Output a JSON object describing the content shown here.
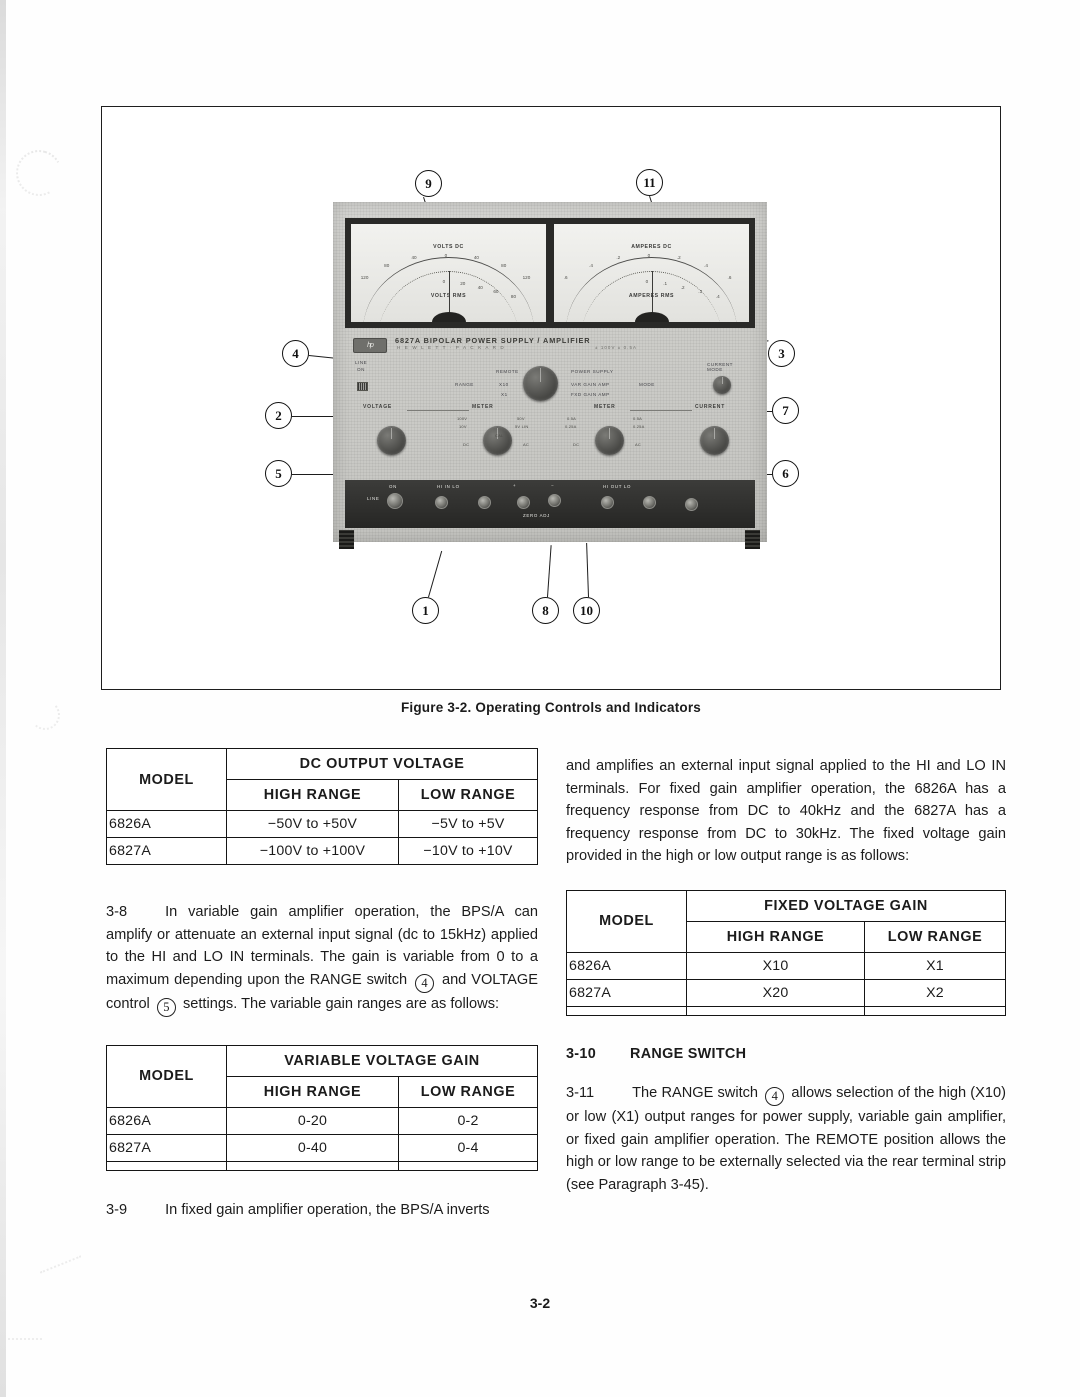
{
  "figure": {
    "caption": "Figure 3-2.  Operating Controls and Indicators",
    "callouts": [
      "9",
      "11",
      "4",
      "3",
      "2",
      "7",
      "5",
      "6",
      "1",
      "8",
      "10"
    ],
    "instrument": {
      "model_title": "6827A  BIPOLAR POWER SUPPLY / AMPLIFIER",
      "brand": "H E W L E T T  ·  P A C K A R D",
      "brand_right": "± 100V      ± 0.5A",
      "hp_logo": "hp",
      "meters": [
        {
          "top_label": "VOLTS DC",
          "bottom_label": "VOLTS RMS",
          "top_ticks": [
            "120",
            "80",
            "40",
            "0",
            "40",
            "80",
            "120"
          ],
          "bottom_ticks": [
            "0",
            "20",
            "40",
            "60",
            "80"
          ]
        },
        {
          "top_label": "AMPERES DC",
          "bottom_label": "AMPERES RMS",
          "top_ticks": [
            ".6",
            ".4",
            ".2",
            "0",
            ".2",
            ".4",
            ".6"
          ],
          "bottom_ticks": [
            "0",
            ".1",
            ".2",
            ".3",
            ".4"
          ]
        }
      ],
      "switch_labels": {
        "line": "LINE",
        "line_on": "ON",
        "range": "RANGE",
        "remote": "REMOTE",
        "x10": "X10",
        "x1": "X1",
        "power_supply": "POWER SUPPLY",
        "var_gain_amp": "VAR GAIN AMP",
        "fxd_gain_amp": "FXD GAIN AMP",
        "mode": "MODE",
        "current_mode": "CURRENT MODE"
      },
      "knob_labels": {
        "voltage": "VOLTAGE",
        "meter_left": "METER",
        "meter_right": "METER",
        "current": "CURRENT",
        "dc": "DC",
        "ac": "AC",
        "volt_ranges": [
          "100V",
          "10V",
          "50V",
          "5V  LIN",
          "CAL"
        ],
        "amp_ranges": [
          "0.5A",
          "0.25A",
          "0.5A",
          "0.25A"
        ]
      },
      "terminal_labels": {
        "line": "LINE",
        "on": "ON",
        "hi_in": "HI   IN   LO",
        "zero_adj": "ZERO  ADJ",
        "hi_out": "HI  OUT  LO",
        "plus": "+",
        "minus": "−"
      }
    }
  },
  "tables": {
    "dc_output": {
      "name": "DC OUTPUT VOLTAGE",
      "model_header": "MODEL",
      "sub_headers": [
        "HIGH RANGE",
        "LOW RANGE"
      ],
      "rows": [
        {
          "model": "6826A",
          "high": "−50V to +50V",
          "low": "−5V to +5V"
        },
        {
          "model": "6827A",
          "high": "−100V to +100V",
          "low": "−10V to +10V"
        }
      ]
    },
    "variable_gain": {
      "name": "VARIABLE VOLTAGE GAIN",
      "model_header": "MODEL",
      "sub_headers": [
        "HIGH RANGE",
        "LOW RANGE"
      ],
      "rows": [
        {
          "model": "6826A",
          "high": "0-20",
          "low": "0-2"
        },
        {
          "model": "6827A",
          "high": "0-40",
          "low": "0-4"
        }
      ]
    },
    "fixed_gain": {
      "name": "FIXED VOLTAGE GAIN",
      "model_header": "MODEL",
      "sub_headers": [
        "HIGH RANGE",
        "LOW RANGE"
      ],
      "rows": [
        {
          "model": "6826A",
          "high": "X10",
          "low": "X1"
        },
        {
          "model": "6827A",
          "high": "X20",
          "low": "X2"
        }
      ]
    }
  },
  "paragraphs": {
    "p3_8_num": "3-8",
    "p3_8_text_a": "In variable gain amplifier operation, the BPS/A can amplify or attenuate an external input signal (dc to 15kHz) applied to the HI and LO IN terminals.  The gain is variable from 0 to a maximum depending upon the RANGE switch",
    "p3_8_ref_1": "4",
    "p3_8_text_b": "and VOLTAGE control",
    "p3_8_ref_2": "5",
    "p3_8_text_c": "settings.  The variable gain ranges are as follows:",
    "p3_9_num": "3-9",
    "p3_9_text": "In fixed gain amplifier operation, the BPS/A inverts",
    "p_cont_text": "and amplifies an external input signal applied to the HI and LO IN terminals.  For fixed gain amplifier operation, the 6826A has a frequency response from DC to 40kHz and the 6827A has a frequency response from DC to 30kHz.  The fixed voltage gain provided in the high or low output range is as follows:",
    "s3_10_num": "3-10",
    "s3_10_title": "RANGE SWITCH",
    "p3_11_num": "3-11",
    "p3_11_text_a": "The RANGE switch",
    "p3_11_ref": "4",
    "p3_11_text_b": "allows selection of the high (X10) or low (X1) output ranges for power supply, variable gain amplifier, or fixed gain amplifier operation.  The REMOTE position allows the high or low range to be externally selected via the rear terminal strip (see Paragraph 3-45)."
  },
  "page_number": "3-2"
}
